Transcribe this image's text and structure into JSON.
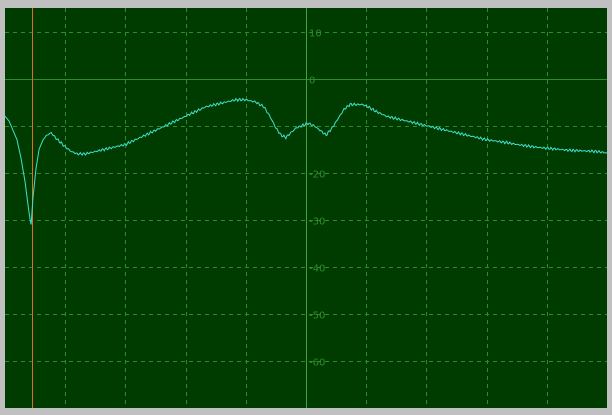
{
  "chart_data": {
    "type": "line",
    "title": "",
    "xlabel": "",
    "ylabel": "",
    "xlim": [
      0,
      600
    ],
    "ylim": [
      -70,
      15
    ],
    "y_ticks": [
      {
        "value": 10,
        "label": "10"
      },
      {
        "value": 0,
        "label": "0"
      },
      {
        "value": -10,
        "label": ""
      },
      {
        "value": -20,
        "label": "-20"
      },
      {
        "value": -30,
        "label": "-30"
      },
      {
        "value": -40,
        "label": "-40"
      },
      {
        "value": -50,
        "label": "-50"
      },
      {
        "value": -60,
        "label": "-60"
      }
    ],
    "x_gridlines": [
      60,
      120,
      180,
      240,
      300,
      360,
      420,
      480,
      540
    ],
    "center_axis_x": 300,
    "marker_x": 27,
    "grid": true,
    "colors": {
      "background": "#003c00",
      "grid": "#2e8b2e",
      "axis": "#3fa33f",
      "trace": "#40e0d0",
      "marker": "#e07020",
      "frame": "#c0c0c0"
    },
    "series": [
      {
        "points": [
          [
            0,
            -8
          ],
          [
            4,
            -9
          ],
          [
            8,
            -11
          ],
          [
            12,
            -13
          ],
          [
            16,
            -17
          ],
          [
            20,
            -22
          ],
          [
            23,
            -27
          ],
          [
            25,
            -30
          ],
          [
            26,
            -31
          ],
          [
            28,
            -25
          ],
          [
            31,
            -19
          ],
          [
            34,
            -15
          ],
          [
            38,
            -13
          ],
          [
            42,
            -12
          ],
          [
            46,
            -11.5
          ],
          [
            50,
            -12.5
          ],
          [
            55,
            -13.5
          ],
          [
            60,
            -14.5
          ],
          [
            66,
            -15.5
          ],
          [
            72,
            -16
          ],
          [
            80,
            -16
          ],
          [
            90,
            -15.5
          ],
          [
            100,
            -15
          ],
          [
            110,
            -14.5
          ],
          [
            120,
            -14
          ],
          [
            130,
            -13
          ],
          [
            140,
            -12
          ],
          [
            150,
            -11
          ],
          [
            160,
            -10
          ],
          [
            170,
            -9
          ],
          [
            180,
            -8
          ],
          [
            190,
            -7
          ],
          [
            200,
            -6
          ],
          [
            210,
            -5.5
          ],
          [
            220,
            -5
          ],
          [
            230,
            -4.5
          ],
          [
            240,
            -4.5
          ],
          [
            250,
            -5
          ],
          [
            258,
            -6
          ],
          [
            264,
            -8
          ],
          [
            270,
            -10.5
          ],
          [
            275,
            -12
          ],
          [
            280,
            -12.5
          ],
          [
            285,
            -11.5
          ],
          [
            290,
            -10.5
          ],
          [
            296,
            -10
          ],
          [
            302,
            -9.5
          ],
          [
            308,
            -10
          ],
          [
            314,
            -11
          ],
          [
            320,
            -12
          ],
          [
            326,
            -10.5
          ],
          [
            332,
            -8.5
          ],
          [
            338,
            -6.5
          ],
          [
            344,
            -5.5
          ],
          [
            350,
            -5.5
          ],
          [
            356,
            -5.5
          ],
          [
            362,
            -6
          ],
          [
            370,
            -7
          ],
          [
            380,
            -8
          ],
          [
            390,
            -8.5
          ],
          [
            400,
            -9
          ],
          [
            410,
            -9.5
          ],
          [
            420,
            -10
          ],
          [
            430,
            -10.5
          ],
          [
            440,
            -11
          ],
          [
            450,
            -11.5
          ],
          [
            460,
            -12
          ],
          [
            470,
            -12.5
          ],
          [
            480,
            -13
          ],
          [
            490,
            -13.3
          ],
          [
            500,
            -13.6
          ],
          [
            510,
            -14
          ],
          [
            520,
            -14.3
          ],
          [
            530,
            -14.6
          ],
          [
            540,
            -14.8
          ],
          [
            550,
            -15
          ],
          [
            560,
            -15.2
          ],
          [
            570,
            -15.3
          ],
          [
            580,
            -15.4
          ],
          [
            590,
            -15.5
          ],
          [
            600,
            -15.8
          ]
        ]
      }
    ]
  }
}
